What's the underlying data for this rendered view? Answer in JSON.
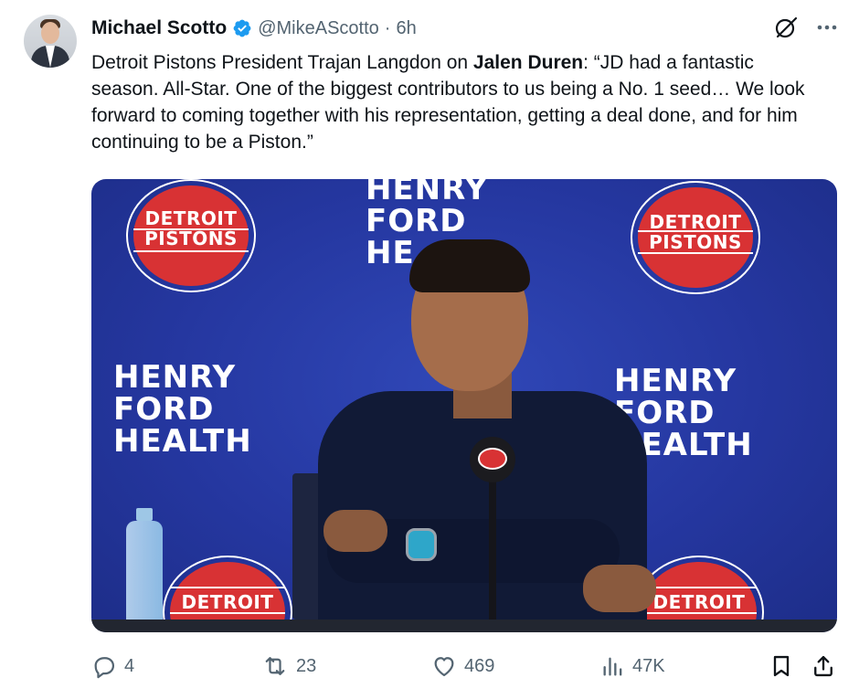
{
  "tweet": {
    "author_name": "Michael Scotto",
    "handle": "@MikeAScotto",
    "separator": "·",
    "time": "6h",
    "text_before": "Detroit Pistons President Trajan Langdon on ",
    "mention": "Jalen Duren",
    "text_after": ": “JD had a fantastic season. All-Star. One of the biggest contributors to us being a No. 1 seed… We look forward to coming together with his representation, getting a deal done, and for him continuing to be a Piston.”"
  },
  "media": {
    "logo_text_line1": "DETROIT",
    "logo_text_line2": "PISTONS",
    "logo_bottom_text": "DETROIT",
    "sponsor_line1": "HENRY",
    "sponsor_line2": "FORD",
    "sponsor_line3": "HEALTH",
    "sponsor_line3_partial": "HE"
  },
  "actions": {
    "replies": "4",
    "reposts": "23",
    "likes": "469",
    "views": "47K"
  },
  "icons": {
    "verified": "verified-badge-icon",
    "grok": "grok-icon",
    "more": "more-icon",
    "reply": "reply-icon",
    "repost": "repost-icon",
    "like": "heart-icon",
    "views": "views-icon",
    "bookmark": "bookmark-icon",
    "share": "share-icon"
  },
  "colors": {
    "accent": "#1d9bf0",
    "muted": "#536471",
    "pistons_red": "#d83234",
    "backdrop_blue": "#2537a0"
  }
}
